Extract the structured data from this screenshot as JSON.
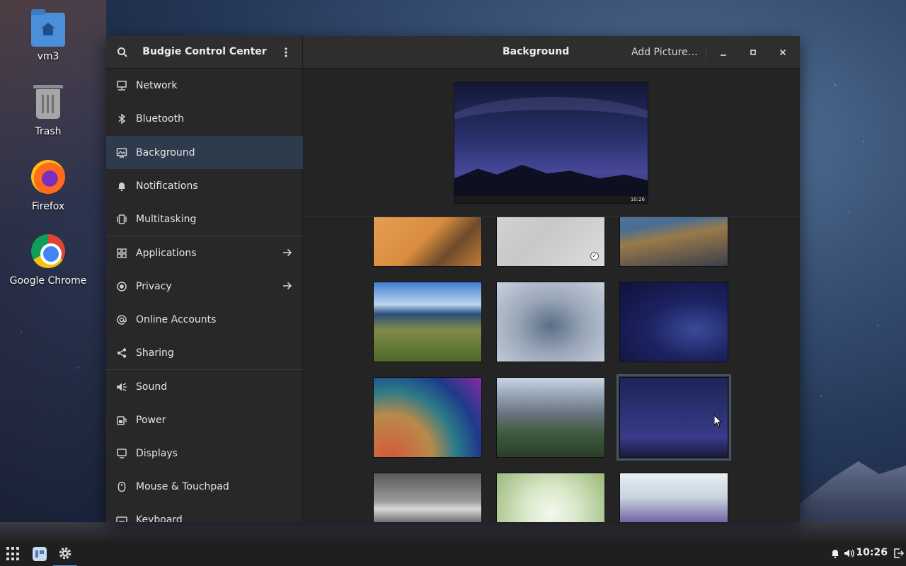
{
  "desktop": {
    "icons": [
      {
        "label": "vm3",
        "icon": "home-folder-icon"
      },
      {
        "label": "Trash",
        "icon": "trash-icon"
      },
      {
        "label": "Firefox",
        "icon": "firefox-icon"
      },
      {
        "label": "Google Chrome",
        "icon": "chrome-icon"
      }
    ]
  },
  "window": {
    "sidebar_title": "Budgie Control Center",
    "page_title": "Background",
    "add_picture_label": "Add Picture…"
  },
  "sidebar": {
    "items": [
      {
        "label": "Network",
        "icon": "network-icon"
      },
      {
        "label": "Bluetooth",
        "icon": "bluetooth-icon"
      },
      {
        "label": "Background",
        "icon": "background-icon",
        "active": true
      },
      {
        "label": "Notifications",
        "icon": "bell-icon"
      },
      {
        "label": "Multitasking",
        "icon": "multitasking-icon"
      },
      {
        "label": "Applications",
        "icon": "apps-icon",
        "has_arrow": true
      },
      {
        "label": "Privacy",
        "icon": "privacy-icon",
        "has_arrow": true
      },
      {
        "label": "Online Accounts",
        "icon": "at-icon"
      },
      {
        "label": "Sharing",
        "icon": "share-icon"
      },
      {
        "label": "Sound",
        "icon": "speaker-icon"
      },
      {
        "label": "Power",
        "icon": "power-icon"
      },
      {
        "label": "Displays",
        "icon": "display-icon"
      },
      {
        "label": "Mouse & Touchpad",
        "icon": "mouse-icon"
      },
      {
        "label": "Keyboard",
        "icon": "keyboard-icon"
      }
    ]
  },
  "preview": {
    "clock": "10:26"
  },
  "taskbar": {
    "clock": "10:26"
  }
}
